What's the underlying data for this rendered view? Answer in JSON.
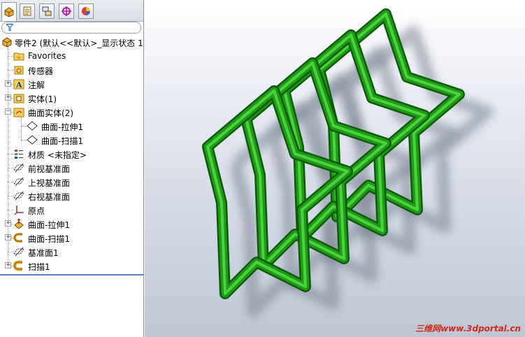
{
  "panel": {
    "tabs": [
      {
        "icon": "feature-manager-icon",
        "active": true
      },
      {
        "icon": "property-manager-icon",
        "active": false
      },
      {
        "icon": "configuration-manager-icon",
        "active": false
      },
      {
        "icon": "dimxpert-icon",
        "active": false
      },
      {
        "icon": "display-manager-icon",
        "active": false
      }
    ],
    "filter_icon": "funnel-icon"
  },
  "tree": {
    "root_label": "零件2  (默认<<默认>_显示状态 1",
    "items": [
      {
        "label": "Favorites",
        "icon": "favorites-folder-icon"
      },
      {
        "label": "传感器",
        "icon": "sensor-icon"
      },
      {
        "label": "注解",
        "icon": "annotations-icon"
      },
      {
        "label": "实体(1)",
        "icon": "solid-bodies-folder-icon"
      },
      {
        "label": "曲面实体(2)",
        "icon": "surface-bodies-folder-icon"
      },
      {
        "label": "曲面-拉伸1",
        "icon": "surface-body-icon"
      },
      {
        "label": "曲面-扫描1",
        "icon": "surface-body-icon"
      },
      {
        "label": "材质 <未指定>",
        "icon": "material-icon"
      },
      {
        "label": "前视基准面",
        "icon": "plane-icon"
      },
      {
        "label": "上视基准面",
        "icon": "plane-icon"
      },
      {
        "label": "右视基准面",
        "icon": "plane-icon"
      },
      {
        "label": "原点",
        "icon": "origin-icon"
      },
      {
        "label": "曲面-拉伸1",
        "icon": "surface-extrude-icon"
      },
      {
        "label": "曲面-扫描1",
        "icon": "surface-sweep-icon"
      },
      {
        "label": "基准面1",
        "icon": "plane-icon"
      },
      {
        "label": "扫描1",
        "icon": "sweep-icon"
      }
    ]
  },
  "viewport": {
    "model_color": "#1f9a17",
    "model_dark": "#0d5a09",
    "shadow_color": "#7d8596",
    "watermark": "三维网www.3dportal.cn"
  }
}
